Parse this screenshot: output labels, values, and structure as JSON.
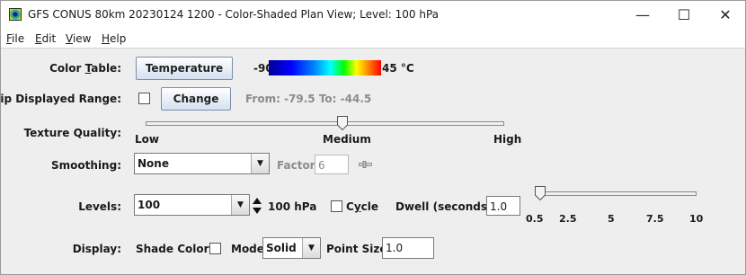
{
  "window": {
    "title": "GFS CONUS 80km 20230124 1200 - Color-Shaded Plan View; Level: 100 hPa",
    "controls": {
      "minimize": "—",
      "maximize": "☐",
      "close": "✕"
    }
  },
  "menu": [
    {
      "mnemonic": "F",
      "rest": "ile"
    },
    {
      "mnemonic": "E",
      "rest": "dit"
    },
    {
      "mnemonic": "V",
      "rest": "iew"
    },
    {
      "mnemonic": "H",
      "rest": "elp"
    }
  ],
  "color_table": {
    "label_pre": "Color ",
    "label_mn": "T",
    "label_post": "able:",
    "button": "Temperature",
    "min": "-90",
    "max": "45 °C"
  },
  "clip": {
    "label": "Clip Displayed Range:",
    "checked": false,
    "button": "Change",
    "range_text": "From: -79.5 To: -44.5"
  },
  "texture": {
    "label": "Texture Quality:",
    "value_fraction": 0.5,
    "ticks": [
      "Low",
      "Medium",
      "High"
    ]
  },
  "smoothing": {
    "label": "Smoothing:",
    "value": "None",
    "factor_label": "Factor:",
    "factor_value": "6"
  },
  "levels": {
    "label": "Levels:",
    "value": "100",
    "unit_text": "100 hPa",
    "cycle_pre": "C",
    "cycle_mn": "y",
    "cycle_post": "cle",
    "cycle_checked": false,
    "dwell_label": "Dwell (seconds):",
    "dwell_value": "1.0",
    "dwell_slider_value": 1.0,
    "dwell_ticks": [
      "0.5",
      "2.5",
      "5",
      "7.5",
      "10"
    ]
  },
  "display": {
    "label": "Display:",
    "shade_label": "Shade Colors:",
    "shade_checked": false,
    "mode_label": "Mode:",
    "mode_value": "Solid",
    "point_size_label": "Point Size:",
    "point_size_value": "1.0"
  }
}
